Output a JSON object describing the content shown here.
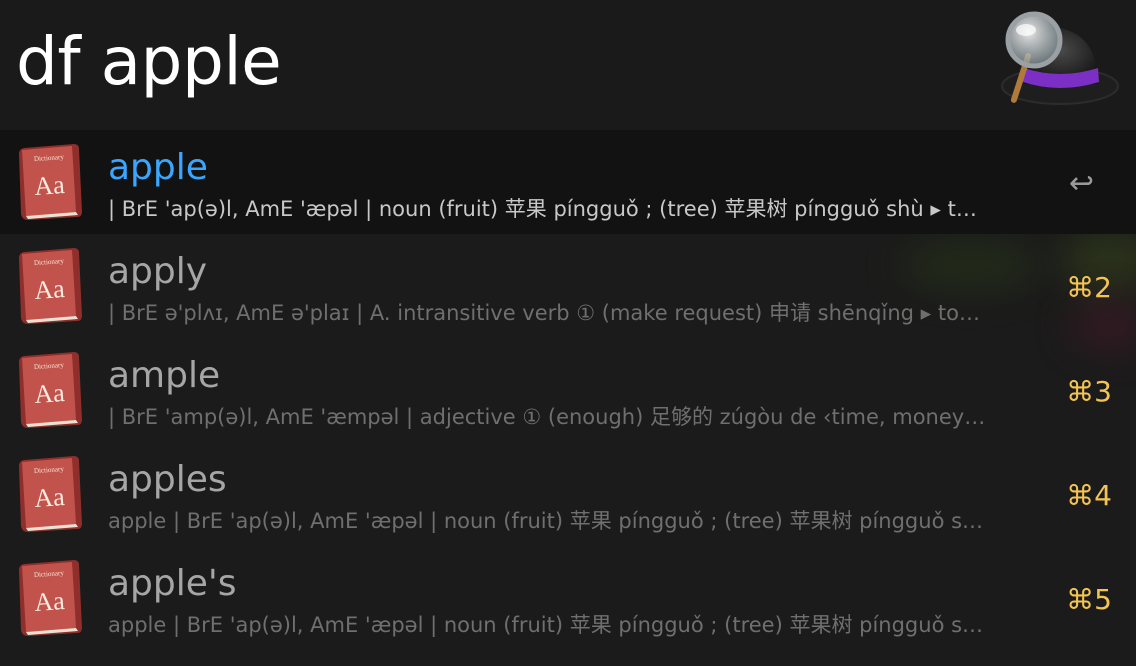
{
  "search": {
    "query": "df apple"
  },
  "results": [
    {
      "title": "apple",
      "subtitle": "| BrE 'ap(ə)l, AmE 'æpəl | noun (fruit) 苹果 píngguǒ ; (tree) 苹果树 píngguǒ shù ▸ t…",
      "shortcut": "↩",
      "icon": "dictionary-icon",
      "selected": true
    },
    {
      "title": "apply",
      "subtitle": "| BrE ə'plʌɪ, AmE ə'plaɪ | A. intransitive verb ① (make request) 申请 shēnqǐng ▸ to…",
      "shortcut": "⌘2",
      "icon": "dictionary-icon",
      "selected": false
    },
    {
      "title": "ample",
      "subtitle": "| BrE 'amp(ə)l, AmE 'æmpəl | adjective ① (enough) 足够的 zúgòu de ‹time, money…",
      "shortcut": "⌘3",
      "icon": "dictionary-icon",
      "selected": false
    },
    {
      "title": "apples",
      "subtitle": "apple | BrE 'ap(ə)l, AmE 'æpəl | noun (fruit) 苹果 píngguǒ ; (tree) 苹果树 píngguǒ s…",
      "shortcut": "⌘4",
      "icon": "dictionary-icon",
      "selected": false
    },
    {
      "title": "apple's",
      "subtitle": "apple | BrE 'ap(ə)l, AmE 'æpəl | noun (fruit) 苹果 píngguǒ ; (tree) 苹果树 píngguǒ s…",
      "shortcut": "⌘5",
      "icon": "dictionary-icon",
      "selected": false
    }
  ],
  "colors": {
    "selected_title": "#3aa6ff",
    "shortcut": "#f4c453",
    "background": "#1b1b1b"
  }
}
